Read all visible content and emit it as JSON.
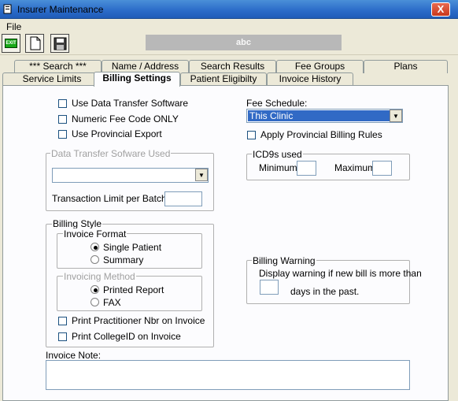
{
  "window": {
    "title": "Insurer Maintenance",
    "close_glyph": "X"
  },
  "menu": {
    "file": "File"
  },
  "toolbar": {
    "exit_label": "EXIT",
    "abc": "abc"
  },
  "tabs_row1": [
    {
      "label": "*** Search ***"
    },
    {
      "label": "Name / Address"
    },
    {
      "label": "Search Results"
    },
    {
      "label": "Fee Groups"
    },
    {
      "label": "Plans"
    }
  ],
  "tabs_row2": [
    {
      "label": "Service Limits"
    },
    {
      "label": "Billing Settings",
      "active": true
    },
    {
      "label": "Patient Eligibilty"
    },
    {
      "label": "Invoice History"
    }
  ],
  "left": {
    "use_data_transfer": "Use Data Transfer Software",
    "numeric_fee_code": "Numeric Fee Code ONLY",
    "use_provincial_export": "Use Provincial Export",
    "dts_group": "Data Transfer Sofware Used",
    "dts_value": "",
    "transaction_limit_label": "Transaction Limit per Batch:",
    "transaction_limit_value": "",
    "billing_style": "Billing Style",
    "invoice_format": "Invoice Format",
    "single_patient": "Single Patient",
    "summary": "Summary",
    "invoicing_method": "Invoicing Method",
    "printed_report": "Printed Report",
    "fax": "FAX",
    "print_practitioner": "Print Practitioner Nbr on Invoice",
    "print_college": "Print CollegeID on Invoice",
    "invoice_note_label": "Invoice Note:",
    "invoice_note_value": ""
  },
  "right": {
    "fee_schedule_label": "Fee Schedule:",
    "fee_schedule_value": "This Clinic",
    "apply_provincial": "Apply Provincial Billing Rules",
    "icd9_group": "ICD9s used",
    "minimum": "Minimum",
    "maximum": "Maximum",
    "minimum_value": "",
    "maximum_value": "",
    "billing_warning": "Billing Warning",
    "warning_text": "Display warning if new bill is more than",
    "days_value": "",
    "days_text": "days in the past."
  },
  "state": {
    "invoice_format_selected": "single_patient",
    "invoicing_method_selected": "printed_report"
  }
}
